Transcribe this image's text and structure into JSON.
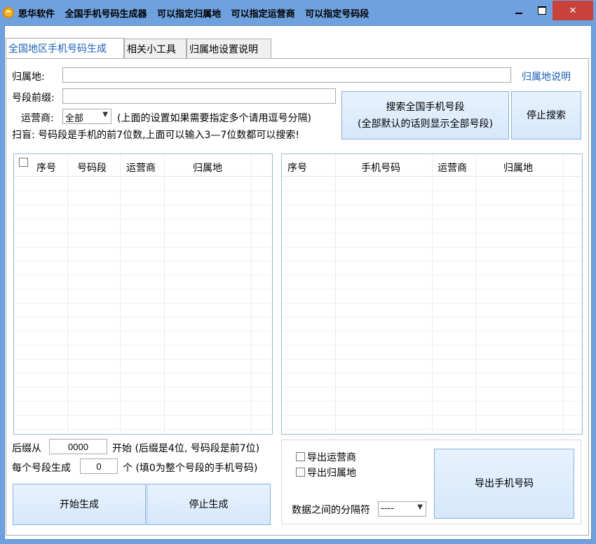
{
  "window": {
    "title_parts": [
      "思华软件",
      "全国手机号码生成器",
      "可以指定归属地",
      "可以指定运营商",
      "可以指定号码段"
    ]
  },
  "tabs": [
    {
      "label": "全国地区手机号码生成",
      "active": true
    },
    {
      "label": "相关小工具",
      "active": false
    },
    {
      "label": "归属地设置说明",
      "active": false
    }
  ],
  "form": {
    "location_label": "归属地:",
    "location_value": "",
    "location_help_link": "归属地说明",
    "prefix_label": "号段前缀:",
    "prefix_value": "",
    "carrier_label": "运营商:",
    "carrier_value": "全部",
    "carrier_hint": "(上面的设置如果需要指定多个请用逗号分隔)",
    "scan_hint": "扫盲: 号码段是手机的前7位数,上面可以输入3—7位数都可以搜索!",
    "search_button": [
      "搜索全国手机号段",
      "(全部默认的话则显示全部号段)"
    ],
    "stop_search_button": "停止搜索"
  },
  "left_table": {
    "columns": [
      "序号",
      "号码段",
      "运营商",
      "归属地"
    ],
    "rows": []
  },
  "right_table": {
    "columns": [
      "序号",
      "手机号码",
      "运营商",
      "归属地"
    ],
    "rows": []
  },
  "generate": {
    "suffix_from_label": "后缀从",
    "suffix_from_value": "0000",
    "suffix_start_hint": "开始 (后缀是4位, 号码段是前7位)",
    "per_segment_label": "每个号段生成",
    "per_segment_value": "0",
    "per_segment_hint": "个 (填0为整个号段的手机号码)",
    "start_button": "开始生成",
    "stop_button": "停止生成"
  },
  "export": {
    "export_carrier_label": "导出运营商",
    "export_location_label": "导出归属地",
    "separator_label": "数据之间的分隔符",
    "separator_value": "----",
    "export_button": "导出手机号码"
  }
}
